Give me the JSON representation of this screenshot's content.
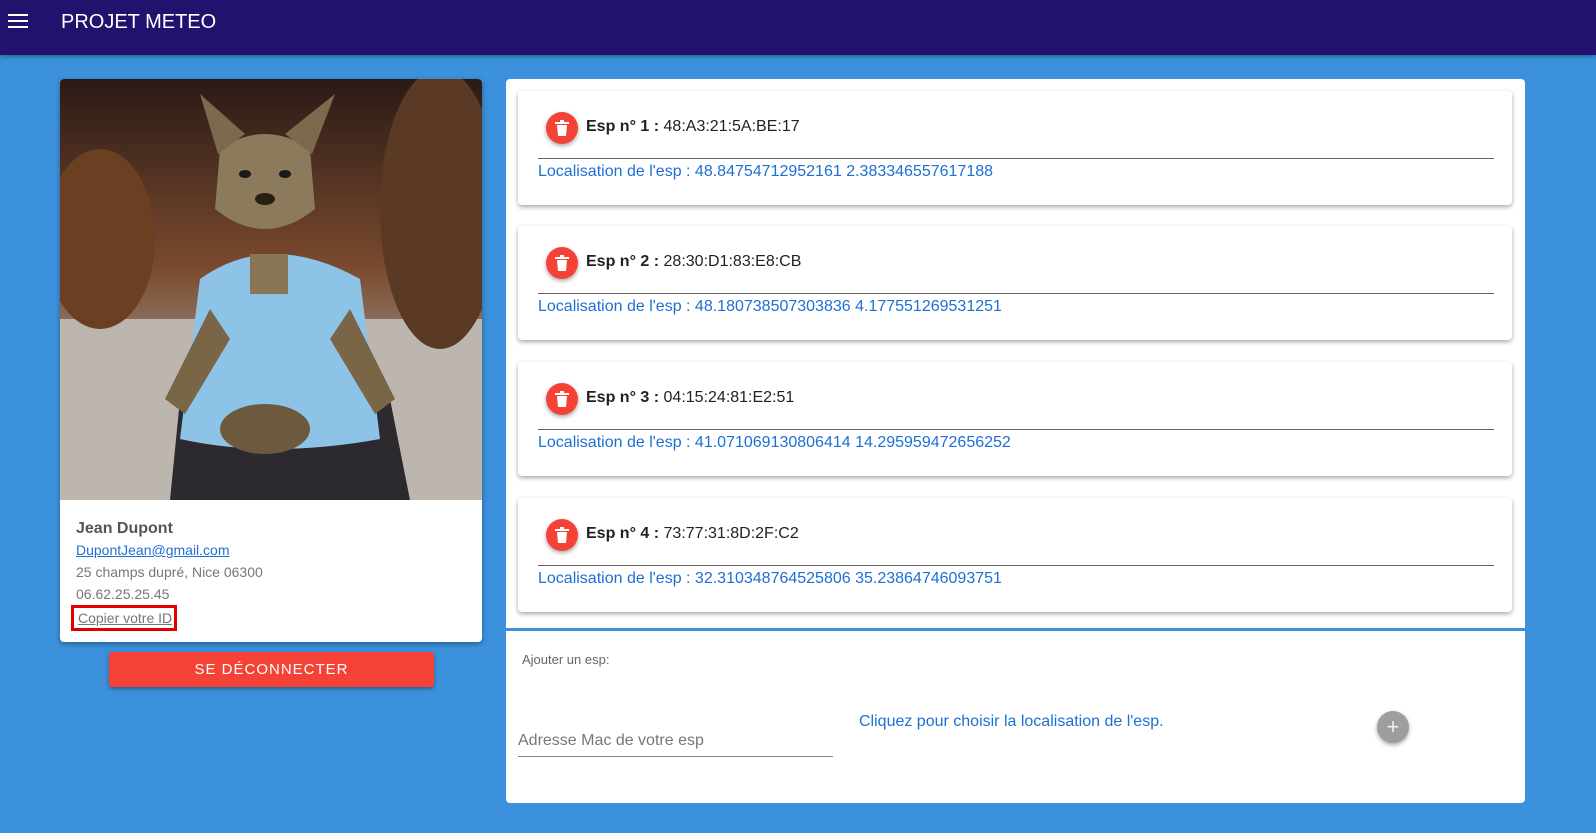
{
  "app": {
    "title": "PROJET METEO"
  },
  "profile": {
    "name": "Jean Dupont",
    "email": "DupontJean@gmail.com",
    "address": "25 champs dupré, Nice 06300",
    "phone": "06.62.25.25.45",
    "copy_id_label": "Copier votre ID",
    "logout_label": "SE DÉCONNECTER"
  },
  "esps": [
    {
      "label": "Esp n° 1 :",
      "mac": "48:A3:21:5A:BE:17",
      "location": "Localisation de l'esp : 48.84754712952161 2.383346557617188"
    },
    {
      "label": "Esp n° 2 :",
      "mac": "28:30:D1:83:E8:CB",
      "location": "Localisation de l'esp : 48.180738507303836 4.177551269531251"
    },
    {
      "label": "Esp n° 3 :",
      "mac": "04:15:24:81:E2:51",
      "location": "Localisation de l'esp : 41.071069130806414 14.295959472656252"
    },
    {
      "label": "Esp n° 4 :",
      "mac": "73:77:31:8D:2F:C2",
      "location": "Localisation de l'esp : 32.310348764525806 35.23864746093751"
    }
  ],
  "add_esp": {
    "label": "Ajouter un esp:",
    "mac_placeholder": "Adresse Mac de votre esp",
    "choose_location": "Cliquez pour choisir la localisation de l'esp.",
    "add_symbol": "+"
  },
  "colors": {
    "appbar": "#23116e",
    "background": "#3c91dc",
    "accent_red": "#f44336",
    "link_blue": "#1e6fd4",
    "highlight": "#e00000"
  },
  "icons": {
    "menu": "hamburger-menu-icon",
    "delete": "trash-icon",
    "add": "plus-icon",
    "profile": "profile-photo"
  }
}
